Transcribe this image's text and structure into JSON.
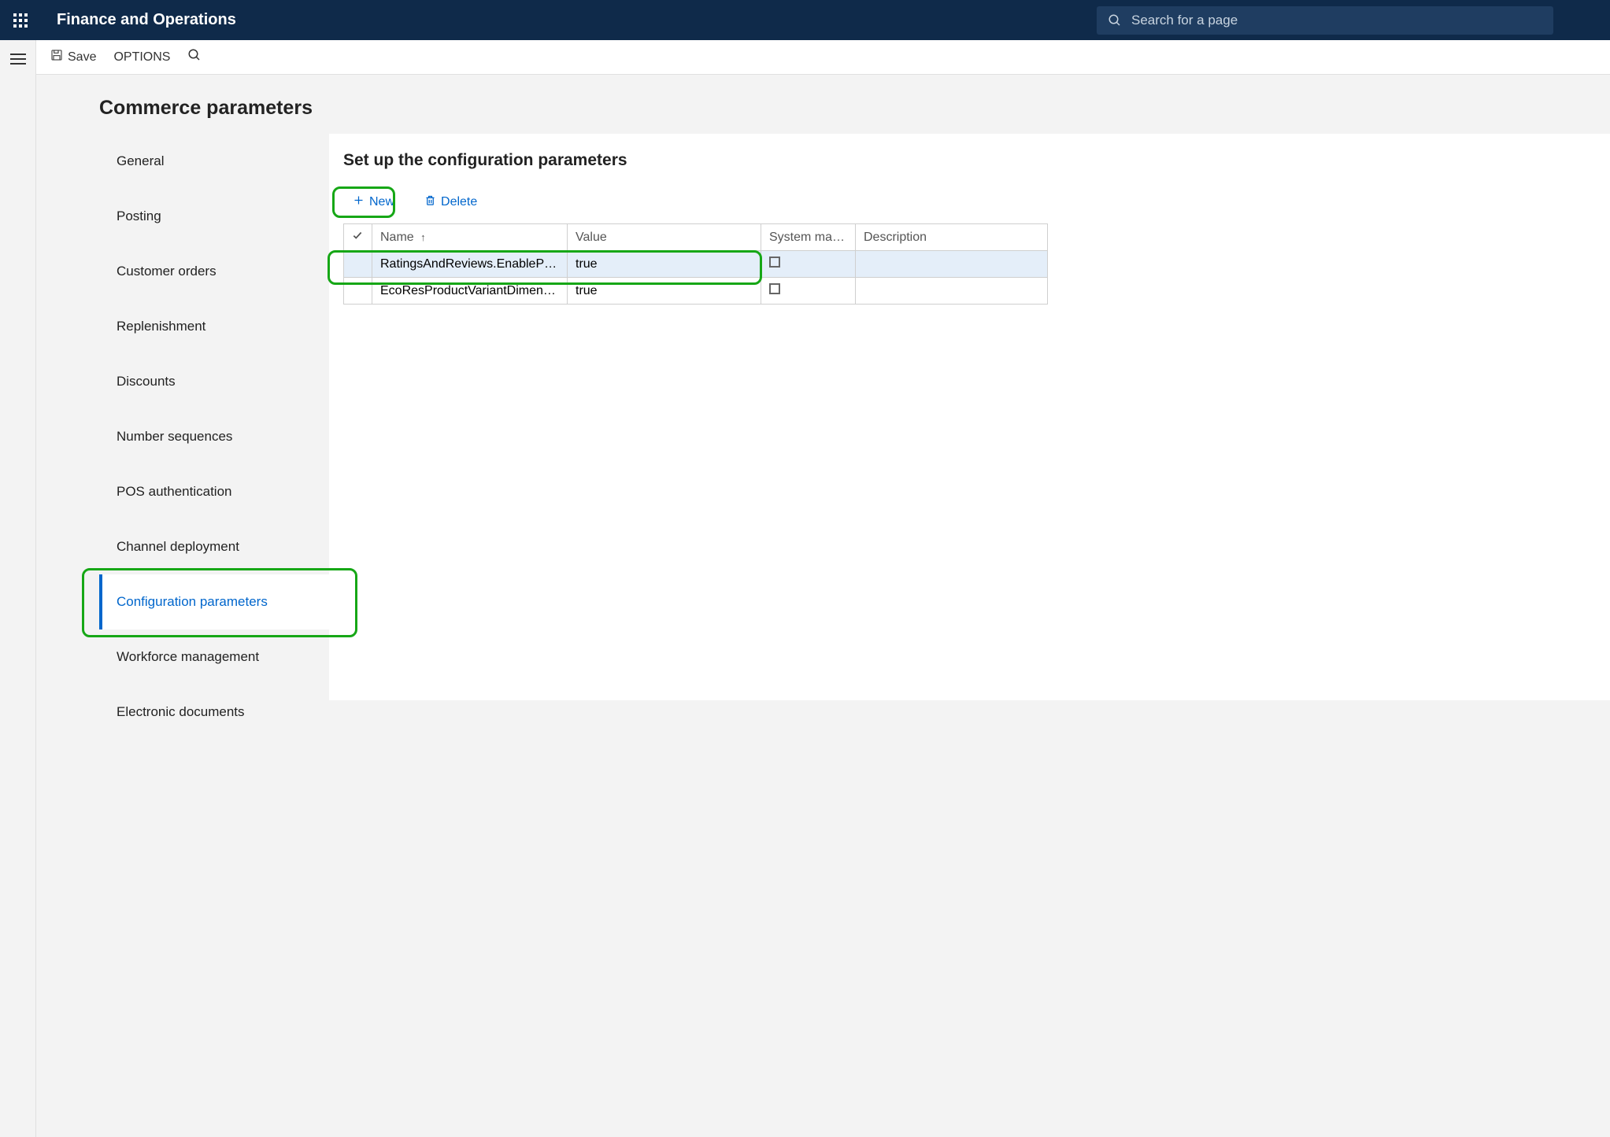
{
  "header": {
    "brand": "Finance and Operations",
    "search_placeholder": "Search for a page"
  },
  "toolbar": {
    "save": "Save",
    "options": "OPTIONS"
  },
  "page": {
    "title": "Commerce parameters"
  },
  "sidebar": {
    "items": [
      {
        "label": "General"
      },
      {
        "label": "Posting"
      },
      {
        "label": "Customer orders"
      },
      {
        "label": "Replenishment"
      },
      {
        "label": "Discounts"
      },
      {
        "label": "Number sequences"
      },
      {
        "label": "POS authentication"
      },
      {
        "label": "Channel deployment"
      },
      {
        "label": "Configuration parameters",
        "selected": true
      },
      {
        "label": "Workforce management"
      },
      {
        "label": "Electronic documents"
      }
    ]
  },
  "panel": {
    "heading": "Set up the configuration parameters",
    "actions": {
      "new": "New",
      "delete": "Delete"
    },
    "columns": {
      "name": "Name",
      "value": "Value",
      "system": "System maintai…",
      "description": "Description"
    },
    "rows": [
      {
        "name": "RatingsAndReviews.EnableProd…",
        "value": "true",
        "selected": true
      },
      {
        "name": "EcoResProductVariantDimensio…",
        "value": "true",
        "selected": false
      }
    ]
  },
  "colors": {
    "accent": "#0066cc",
    "highlight": "#16a716",
    "header": "#0f2a4a"
  }
}
